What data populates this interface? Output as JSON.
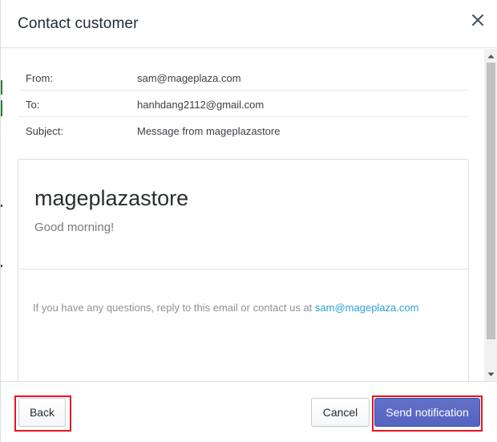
{
  "dialog": {
    "title": "Contact customer",
    "close_icon": "close-icon"
  },
  "meta": {
    "rows": [
      {
        "label": "From:",
        "value": "sam@mageplaza.com"
      },
      {
        "label": "To:",
        "value": "hanhdang2112@gmail.com"
      },
      {
        "label": "Subject:",
        "value": "Message from mageplazastore"
      }
    ]
  },
  "preview": {
    "store_name": "mageplazastore",
    "greeting": "Good morning!",
    "footer_text": "If you have any questions, reply to this email or contact us at ",
    "footer_email": "sam@mageplaza.com"
  },
  "footer": {
    "back_label": "Back",
    "cancel_label": "Cancel",
    "send_label": "Send notification"
  },
  "colors": {
    "primary": "#5c6ac4",
    "link": "#2a9fd6",
    "highlight": "#e8141e"
  }
}
